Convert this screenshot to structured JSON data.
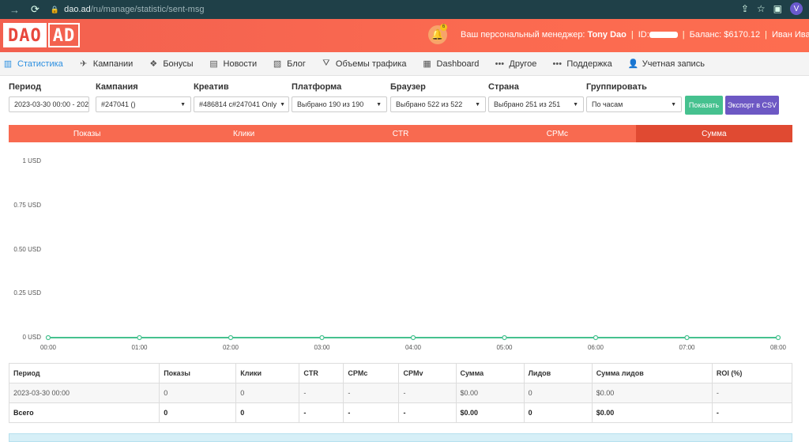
{
  "browser": {
    "url_host": "dao.ad",
    "url_path": "/ru/manage/statistic/sent-msg",
    "profile_initial": "V"
  },
  "header": {
    "logo_left": "DAO",
    "logo_right": "AD",
    "notification_count": "6",
    "manager_label": "Ваш персональный менеджер:",
    "manager_name": "Tony Dao",
    "id_label": "ID:",
    "balance_label": "Баланс:",
    "balance_value": "$6170.12",
    "user_name": "Иван Иванов"
  },
  "menu": {
    "items": [
      {
        "label": "Статистика",
        "icon": "chart-icon"
      },
      {
        "label": "Кампании",
        "icon": "plane-icon"
      },
      {
        "label": "Бонусы",
        "icon": "gift-icon"
      },
      {
        "label": "Новости",
        "icon": "news-icon"
      },
      {
        "label": "Блог",
        "icon": "blog-icon"
      },
      {
        "label": "Объемы трафика",
        "icon": "road-icon"
      },
      {
        "label": "Dashboard",
        "icon": "dashboard-icon"
      },
      {
        "label": "Другое",
        "icon": "dots-icon"
      },
      {
        "label": "Поддержка",
        "icon": "dots-icon"
      },
      {
        "label": "Учетная запись",
        "icon": "user-icon"
      }
    ]
  },
  "filters": {
    "period": {
      "label": "Период",
      "value": "2023-03-30 00:00 - 202"
    },
    "campaign": {
      "label": "Кампания",
      "value": "#247041 ()"
    },
    "creative": {
      "label": "Креатив",
      "value": "#486814 c#247041 Only"
    },
    "platform": {
      "label": "Платформа",
      "value": "Выбрано 190 из 190"
    },
    "browser": {
      "label": "Браузер",
      "value": "Выбрано 522 из 522"
    },
    "country": {
      "label": "Страна",
      "value": "Выбрано 251 из 251"
    },
    "group": {
      "label": "Группировать",
      "value": "По часам"
    },
    "show_button": "Показать",
    "csv_button": "Экспорт в CSV"
  },
  "tabs": [
    {
      "label": "Показы",
      "active": false
    },
    {
      "label": "Клики",
      "active": false
    },
    {
      "label": "CTR",
      "active": false
    },
    {
      "label": "CPMc",
      "active": false
    },
    {
      "label": "Сумма",
      "active": true
    }
  ],
  "chart_data": {
    "type": "line",
    "x": [
      "00:00",
      "01:00",
      "02:00",
      "03:00",
      "04:00",
      "05:00",
      "06:00",
      "07:00",
      "08:00"
    ],
    "series": [
      {
        "values": [
          0,
          0,
          0,
          0,
          0,
          0,
          0,
          0,
          0
        ],
        "color": "#46c18f"
      }
    ],
    "yticks": [
      "0 USD",
      "0.25 USD",
      "0.50 USD",
      "0.75 USD",
      "1 USD"
    ],
    "ylim": [
      0,
      1
    ],
    "grid": false
  },
  "table": {
    "headers": [
      "Период",
      "Показы",
      "Клики",
      "CTR",
      "CPMc",
      "CPMv",
      "Сумма",
      "Лидов",
      "Сумма лидов",
      "ROI (%)"
    ],
    "rows": [
      [
        "2023-03-30 00:00",
        "0",
        "0",
        "-",
        "-",
        "-",
        "$0.00",
        "0",
        "$0.00",
        "-"
      ]
    ],
    "total": [
      "Всего",
      "0",
      "0",
      "-",
      "-",
      "-",
      "$0.00",
      "0",
      "$0.00",
      "-"
    ]
  }
}
